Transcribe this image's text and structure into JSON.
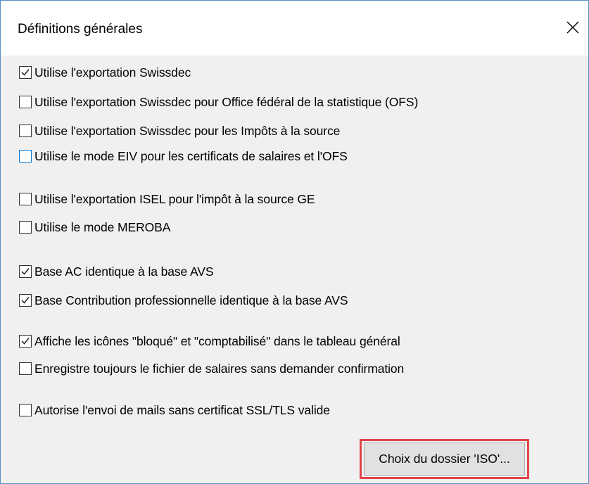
{
  "dialog": {
    "title": "Définitions générales",
    "close_icon": "close-icon"
  },
  "options": [
    {
      "label": "Utilise l'exportation Swissdec",
      "checked": true,
      "focused": false
    },
    {
      "label": "Utilise l'exportation Swissdec pour Office fédéral de la statistique (OFS)",
      "checked": false,
      "focused": false
    },
    {
      "label": "Utilise l'exportation Swissdec pour les Impôts à la source",
      "checked": false,
      "focused": false
    },
    {
      "label": "Utilise le mode EIV pour les certificats de salaires et l'OFS",
      "checked": false,
      "focused": true
    },
    {
      "label": "Utilise l'exportation ISEL pour l'impôt à la source GE",
      "checked": false,
      "focused": false
    },
    {
      "label": "Utilise le mode MEROBA",
      "checked": false,
      "focused": false
    },
    {
      "label": "Base AC identique à la base AVS",
      "checked": true,
      "focused": false
    },
    {
      "label": "Base Contribution professionnelle identique à la base AVS",
      "checked": true,
      "focused": false
    },
    {
      "label": "Affiche les icônes \"bloqué\" et \"comptabilisé\" dans le tableau général",
      "checked": true,
      "focused": false
    },
    {
      "label": "Enregistre toujours le fichier de salaires sans demander confirmation",
      "checked": false,
      "focused": false
    },
    {
      "label": "Autorise l'envoi de mails sans certificat SSL/TLS valide",
      "checked": false,
      "focused": false
    }
  ],
  "iso_button": {
    "label": "Choix du dossier 'ISO'..."
  },
  "colors": {
    "dialog_background": "#f0f0f0",
    "window_border": "#5b8fc9",
    "focus_border": "#0078d7",
    "highlight_outline": "#e0454a",
    "button_face": "#e1e1e1"
  }
}
